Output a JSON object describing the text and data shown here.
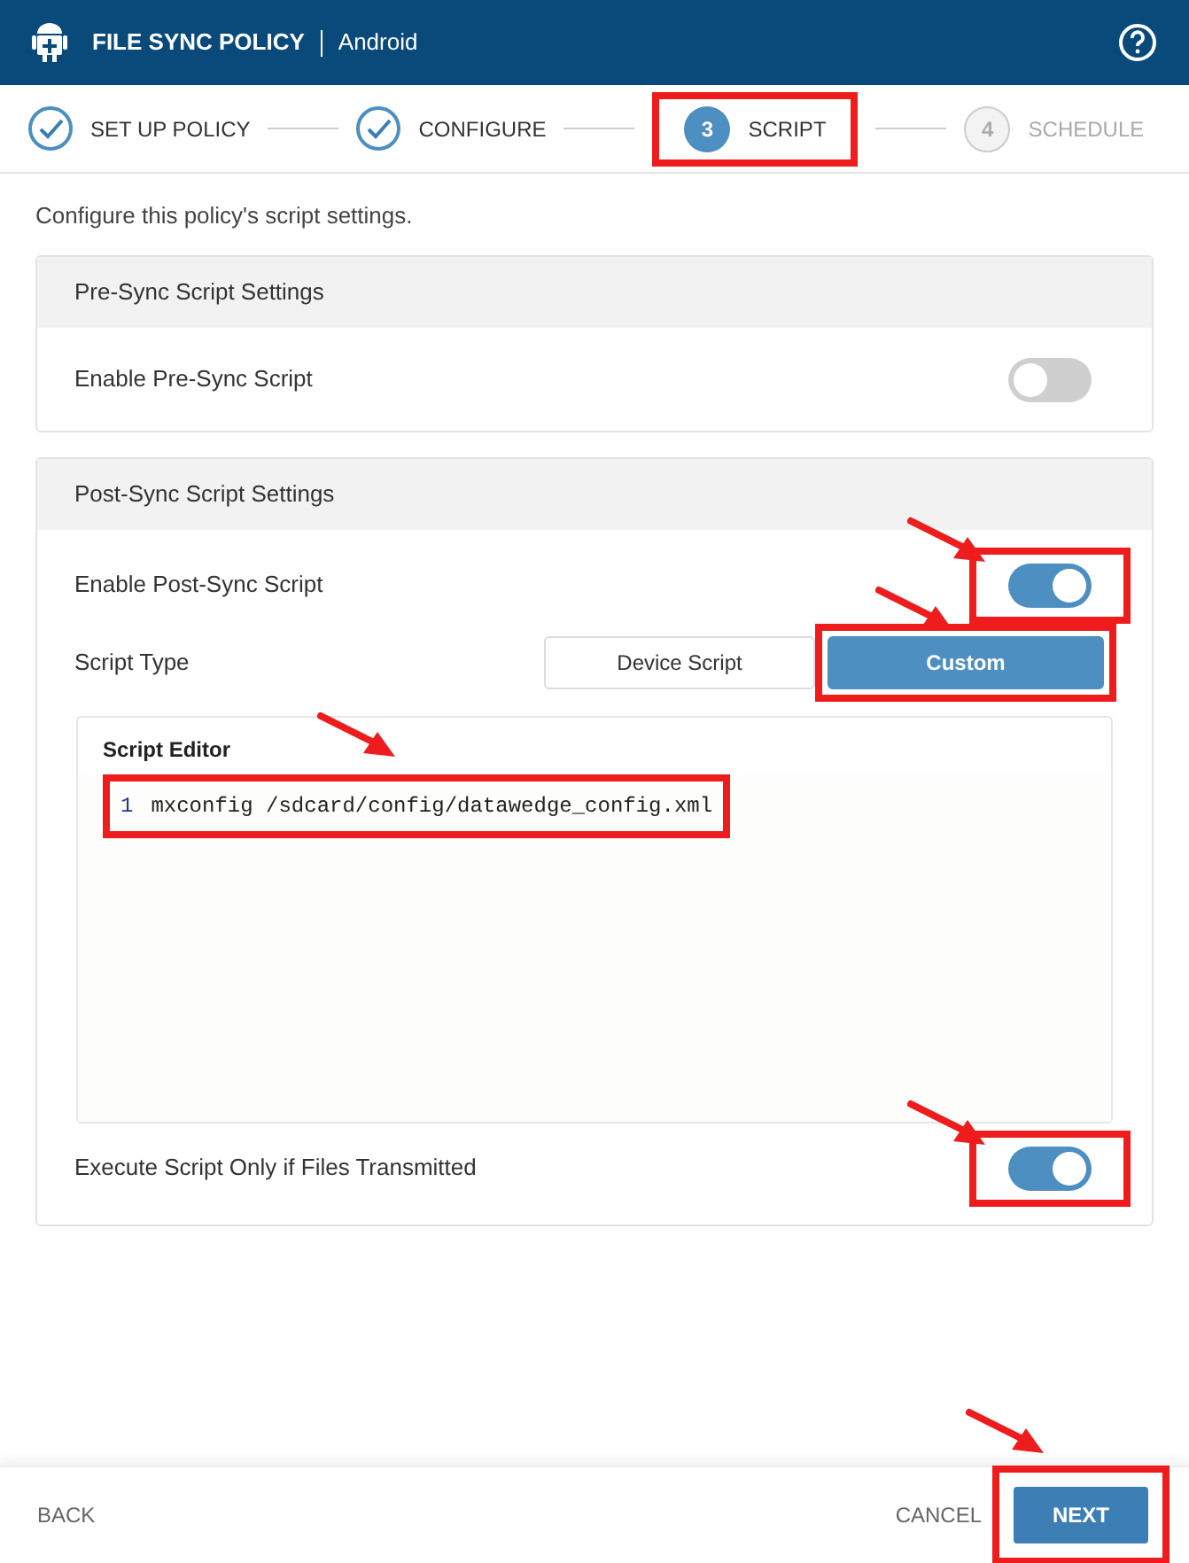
{
  "header": {
    "title": "FILE SYNC POLICY",
    "platform": "Android"
  },
  "steps": [
    {
      "kind": "done",
      "label": "SET UP POLICY",
      "highlighted": false
    },
    {
      "kind": "done",
      "label": "CONFIGURE",
      "highlighted": false
    },
    {
      "number": "3",
      "label": "SCRIPT",
      "kind": "current",
      "highlighted": true
    },
    {
      "number": "4",
      "label": "SCHEDULE",
      "kind": "pending",
      "highlighted": false
    }
  ],
  "description": "Configure this policy's script settings.",
  "pre_sync": {
    "title": "Pre-Sync Script Settings",
    "enable": {
      "label": "Enable Pre-Sync Script",
      "on": false,
      "highlighted": false,
      "arrow": false
    }
  },
  "post_sync": {
    "title": "Post-Sync Script Settings",
    "enable": {
      "label": "Enable Post-Sync Script",
      "on": true,
      "highlighted": true,
      "arrow": true
    },
    "script_type": {
      "label": "Script Type",
      "options": [
        {
          "label": "Device Script",
          "selected": false,
          "highlighted": false
        },
        {
          "label": "Custom",
          "selected": true,
          "highlighted": true
        }
      ],
      "arrow": true
    },
    "editor": {
      "title": "Script Editor",
      "arrow": true,
      "lines": [
        {
          "number": "1",
          "text": "mxconfig /sdcard/config/datawedge_config.xml",
          "highlighted": true
        }
      ]
    },
    "execute": {
      "label": "Execute Script Only if Files Transmitted",
      "on": true,
      "highlighted": true,
      "arrow": true
    }
  },
  "footer": {
    "back": "BACK",
    "cancel": "CANCEL",
    "next": {
      "label": "NEXT",
      "highlighted": true,
      "arrow": true
    }
  }
}
